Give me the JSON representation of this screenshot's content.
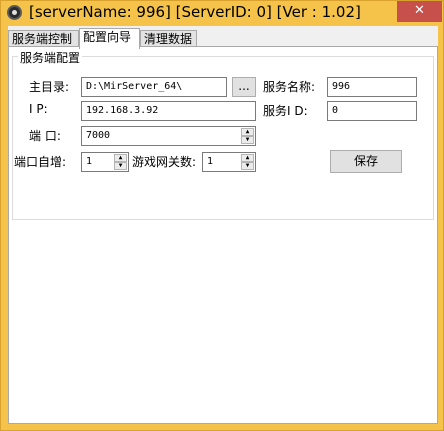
{
  "window": {
    "title": "[serverName: 996] [ServerID: 0] [Ver : 1.02]",
    "close_glyph": "✕"
  },
  "tabs": [
    {
      "label": "服务端控制",
      "active": false
    },
    {
      "label": "配置向导",
      "active": true
    },
    {
      "label": "清理数据",
      "active": false
    }
  ],
  "config": {
    "group_title": "服务端配置",
    "root_dir_label": "主目录:",
    "root_dir_value": "D:\\MirServer_64\\",
    "browse_label": "...",
    "server_name_label": "服务名称:",
    "server_name_value": "996",
    "ip_label": "I    P:",
    "ip_value": "192.168.3.92",
    "server_id_label": "服务I  D:",
    "server_id_value": "0",
    "port_label": "端    口:",
    "port_value": "7000",
    "port_inc_label": "端口自增:",
    "port_inc_value": "1",
    "gate_count_label": "游戏网关数:",
    "gate_count_value": "1",
    "save_label": "保存"
  }
}
